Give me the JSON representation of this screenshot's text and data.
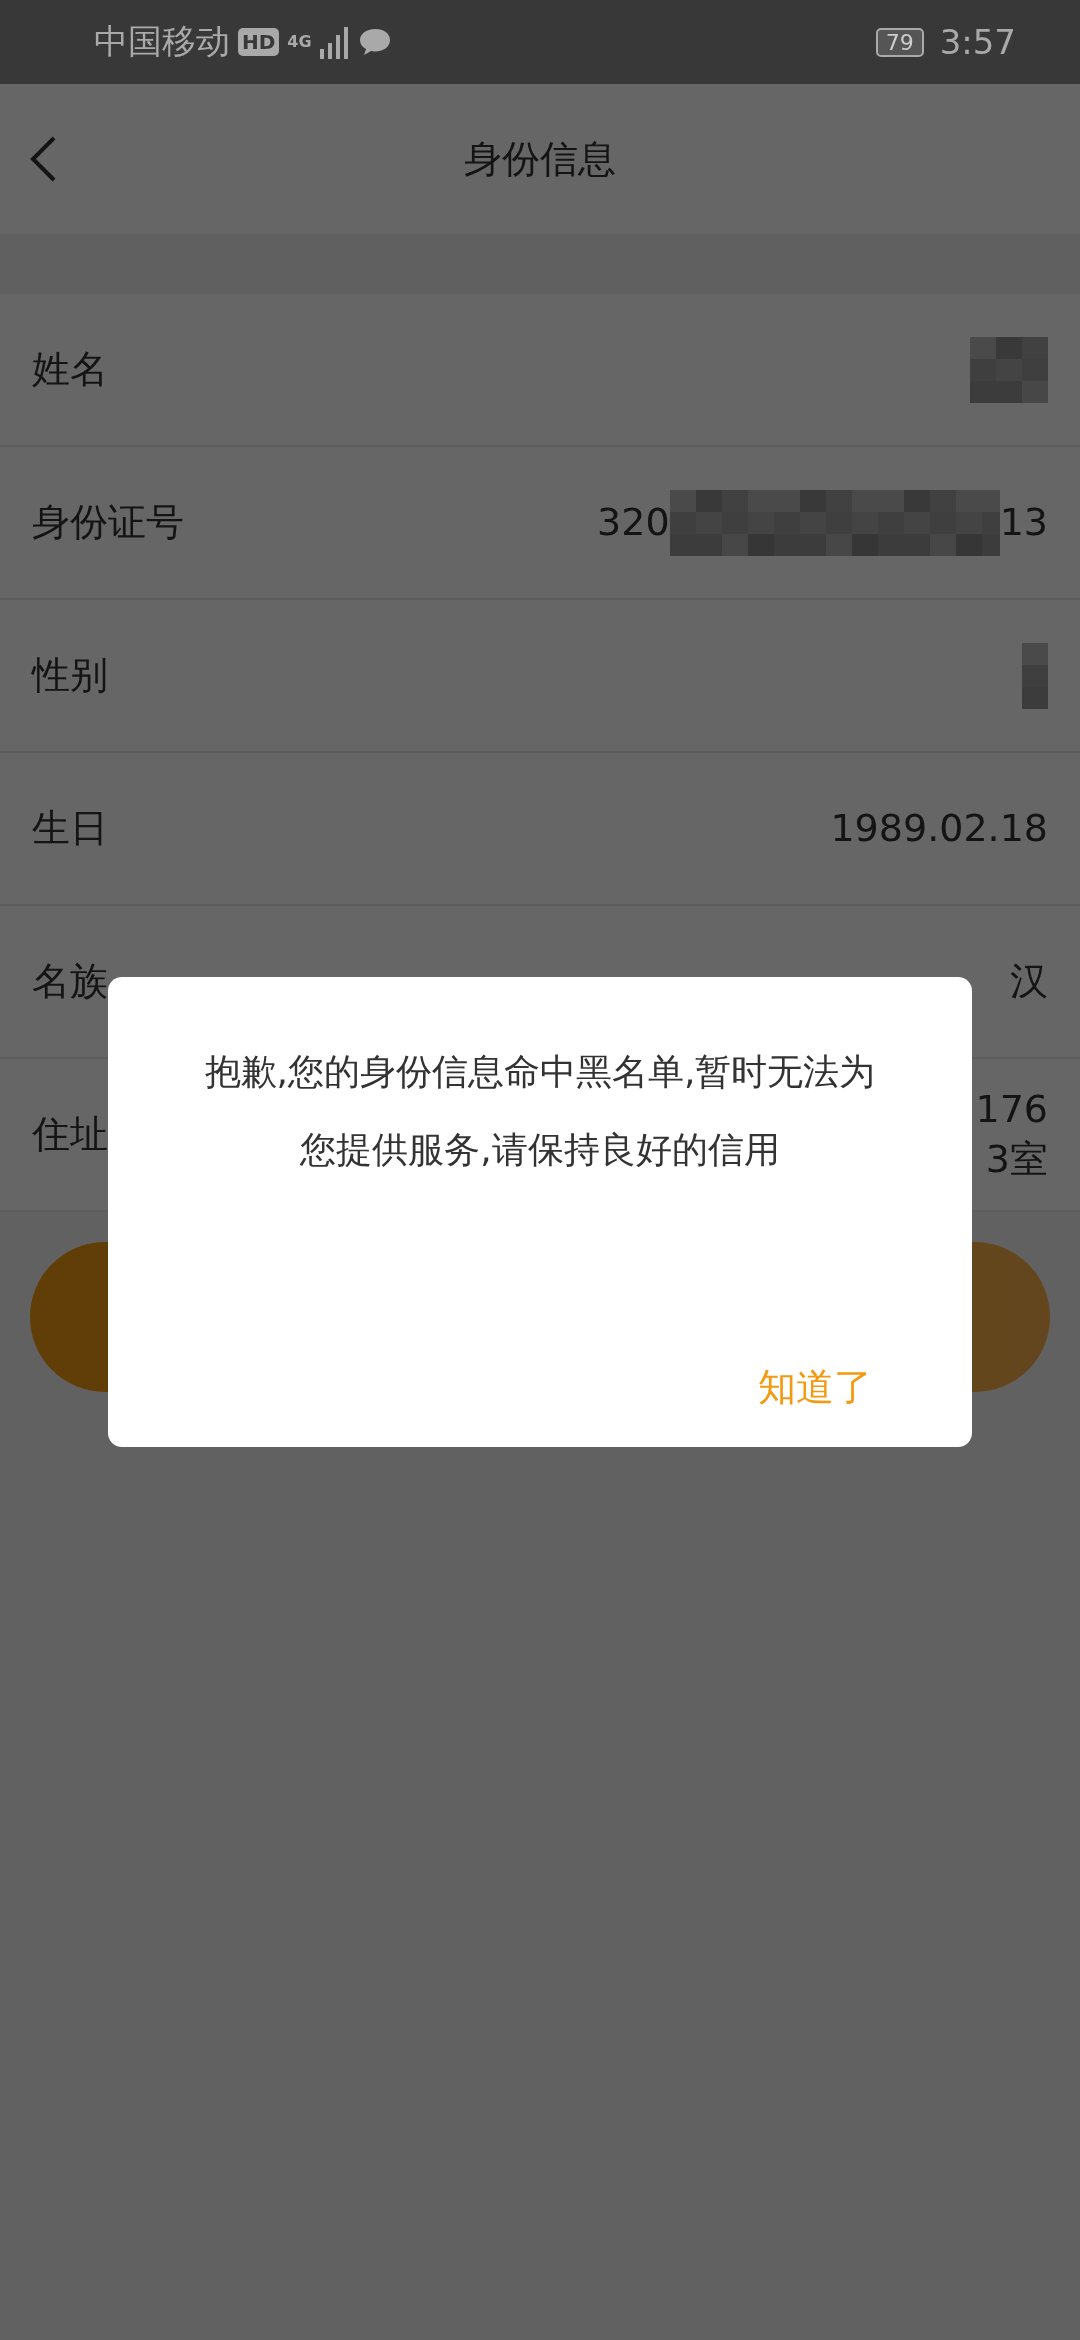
{
  "status_bar": {
    "carrier": "中国移动",
    "hd_badge": "HD",
    "network": "4G",
    "battery": "79",
    "time": "3:57"
  },
  "nav": {
    "title": "身份信息"
  },
  "rows": [
    {
      "label": "姓名",
      "kind": "wide-mosaic"
    },
    {
      "label": "身份证号",
      "kind": "partial",
      "value_start": "320",
      "value_end": "13"
    },
    {
      "label": "性别",
      "kind": "narrow-mosaic"
    },
    {
      "label": "生日",
      "kind": "text",
      "value": "1989.02.18"
    },
    {
      "label": "名族",
      "kind": "text",
      "value": "汉"
    },
    {
      "label": "住址",
      "kind": "lines",
      "lines": [
        "176",
        "3室"
      ]
    }
  ],
  "dialog": {
    "message": "抱歉,您的身份信息命中黑名单,暂时无法为您提供服务,请保持良好的信用",
    "button": "知道了"
  }
}
